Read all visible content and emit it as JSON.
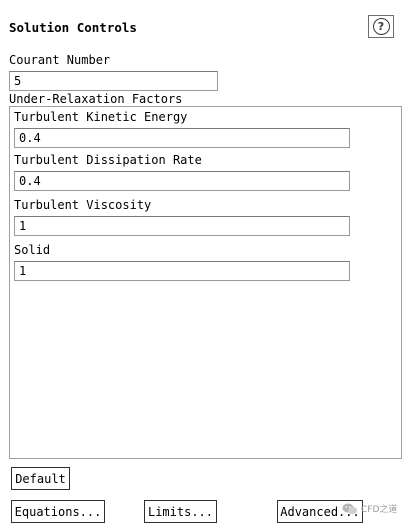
{
  "header": {
    "title": "Solution Controls",
    "help_icon": "question-circle-icon",
    "help_glyph": "?"
  },
  "courant": {
    "label": "Courant Number",
    "value": "5"
  },
  "relaxation": {
    "group_label": "Under-Relaxation Factors",
    "fields": [
      {
        "label": "Turbulent Kinetic Energy",
        "value": "0.4"
      },
      {
        "label": "Turbulent Dissipation Rate",
        "value": "0.4"
      },
      {
        "label": "Turbulent Viscosity",
        "value": "1"
      },
      {
        "label": "Solid",
        "value": "1"
      }
    ]
  },
  "buttons": {
    "default": "Default",
    "equations": "Equations...",
    "limits": "Limits...",
    "advanced": "Advanced..."
  },
  "watermark": {
    "text": "CFD之道",
    "icon": "wechat-logo-icon"
  }
}
